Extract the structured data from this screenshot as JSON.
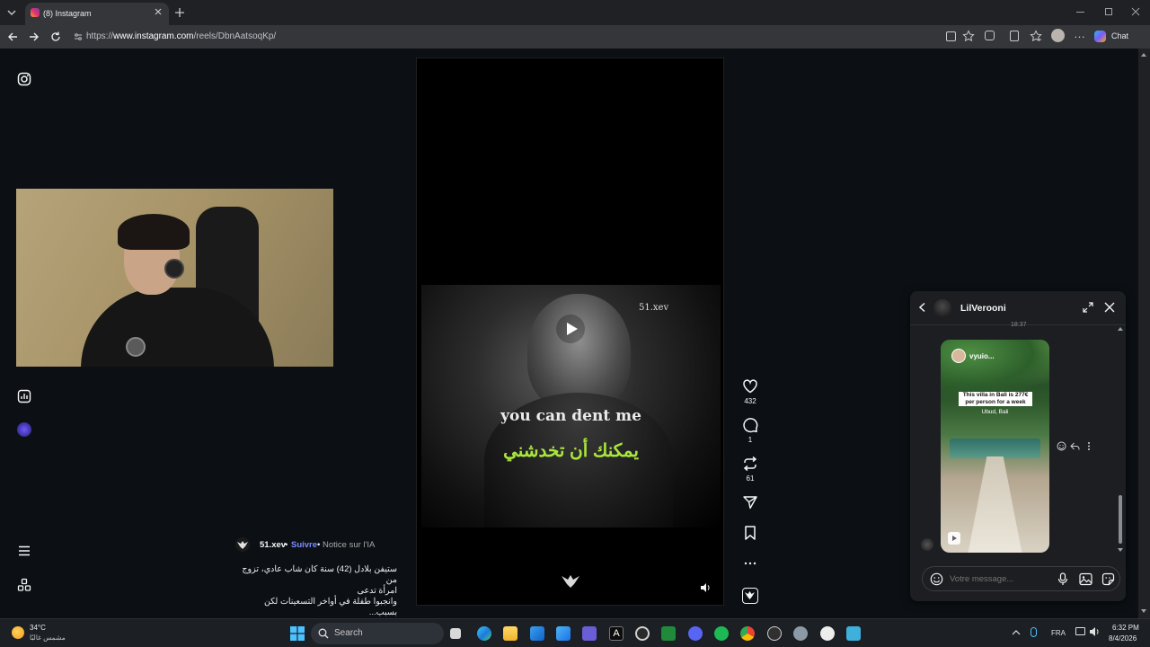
{
  "browser": {
    "tab_title": "(8) Instagram",
    "url_prefix": "https://",
    "url_domain": "www.instagram.com",
    "url_path": "/reels/DbnAatsoqKp/",
    "chat_label": "Chat"
  },
  "reel": {
    "caption_en": "you can dent me",
    "caption_ar": "يمكنك أن تخدشني",
    "watermark": "51.xev",
    "likes": "432",
    "comments": "1",
    "reposts": "61"
  },
  "post": {
    "author": "51.xev",
    "separator": "•",
    "follow": "Suivre",
    "ai_label": "Notice sur l'IA",
    "description_line1": "ستيفن بلادل (42) سنة كان شاب عادي، تزوج من",
    "description_line2": "امرأة تدعى",
    "description_line3": "وانجبوا طفلة في أواخر التسعينات لكن بسبب..."
  },
  "dm": {
    "contact": "LilVerooni",
    "timestamp": "18:37",
    "thumb_user": "vyuio...",
    "thumb_title": "This villa in Bali is 277€ per person for a week",
    "thumb_location": "Ubud, Bali",
    "input_placeholder": "Votre message..."
  },
  "taskbar": {
    "weather_temp": "34°C",
    "weather_desc": "مشمس غالبًا",
    "search_label": "Search",
    "language": "FRA",
    "time": "6:32 PM",
    "date": "8/4/2026"
  },
  "colors": {
    "accent_follow": "#7b8cff",
    "caption_arabic": "#a9e63b",
    "page_bg": "#0c1014"
  }
}
